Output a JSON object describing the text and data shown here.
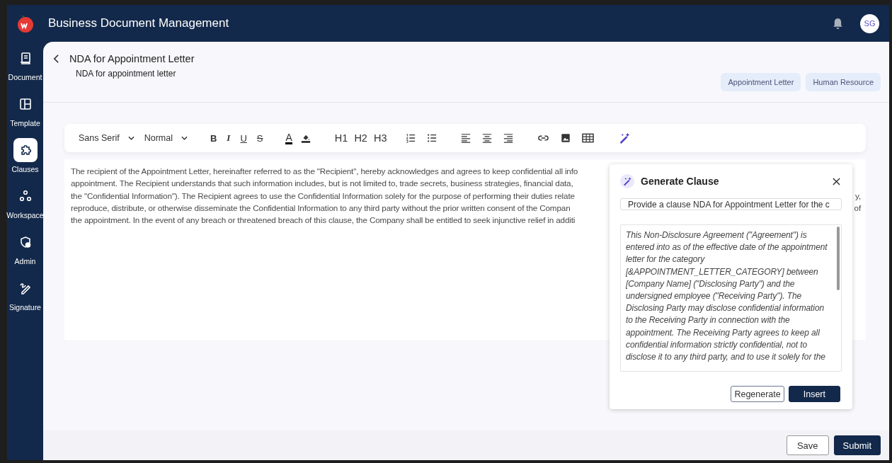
{
  "header": {
    "title": "Business Document Management",
    "avatar": "SG"
  },
  "sidebar": {
    "items": [
      {
        "kind": "document",
        "label": "Document",
        "selected": false
      },
      {
        "kind": "template",
        "label": "Template",
        "selected": false
      },
      {
        "kind": "clauses",
        "label": "Clauses",
        "selected": true
      },
      {
        "kind": "workspace",
        "label": "Workspace",
        "selected": false
      },
      {
        "kind": "admin",
        "label": "Admin",
        "selected": false
      },
      {
        "kind": "signature",
        "label": "Signature",
        "selected": false
      }
    ]
  },
  "page": {
    "title": "NDA for Appointment Letter",
    "subtitle": "NDA for appointment letter",
    "tags": [
      "Appointment Letter",
      "Human Resource"
    ]
  },
  "toolbar": [
    {
      "kind": "select",
      "value": "Sans Serif"
    },
    {
      "kind": "select",
      "value": "Normal"
    },
    {
      "kind": "bold",
      "label": "B"
    },
    {
      "kind": "italic",
      "label": "I"
    },
    {
      "kind": "underline",
      "label": "U"
    },
    {
      "kind": "strike",
      "label": "S"
    },
    {
      "kind": "text-color",
      "label": "A"
    },
    {
      "kind": "highlight"
    },
    {
      "kind": "heading",
      "label": "H1"
    },
    {
      "kind": "heading",
      "label": "H2"
    },
    {
      "kind": "heading",
      "label": "H3"
    },
    {
      "kind": "ordered-list"
    },
    {
      "kind": "bullet-list"
    },
    {
      "kind": "align-left"
    },
    {
      "kind": "align-center"
    },
    {
      "kind": "align-right"
    },
    {
      "kind": "link"
    },
    {
      "kind": "image"
    },
    {
      "kind": "table"
    },
    {
      "kind": "magic"
    }
  ],
  "editor": {
    "lines": [
      {
        "text": "The recipient of the Appointment Letter, hereinafter referred to as the \"Recipient\", hereby acknowledges and agrees to keep confidential all info"
      },
      {
        "text": "appointment. The Recipient understands that such information includes, but is not limited to, trade secrets, business strategies, financial data,"
      },
      {
        "text": "the \"Confidential Information\"). The Recipient agrees to use the Confidential Information solely for the purpose of performing their duties relate",
        "tail": "y,"
      },
      {
        "text": "reproduce, distribute, or otherwise disseminate the Confidential Information to any third party without the prior written consent of the Compan",
        "tail": "of"
      },
      {
        "text": "the appointment. In the event of any breach or threatened breach of this clause, the Company shall be entitled to seek injunctive relief in additi"
      }
    ]
  },
  "dialog": {
    "title": "Generate Clause",
    "prompt": "Provide a clause NDA for Appointment Letter for the c",
    "result": "This Non-Disclosure Agreement (\"Agreement\") is entered into as of the effective date of the appointment letter for the category [&APPOINTMENT_LETTER_CATEGORY] between [Company Name] (\"Disclosing Party\") and the undersigned employee (\"Receiving Party\"). The Disclosing Party may disclose confidential information to the Receiving Party in connection with the appointment. The Receiving Party agrees to keep all confidential information strictly confidential, not to disclose it to any third party, and to use it solely for the",
    "buttons": [
      {
        "kind": "secondary",
        "label": "Regenerate"
      },
      {
        "kind": "primary",
        "label": "Insert"
      }
    ]
  },
  "footer": {
    "buttons": [
      {
        "kind": "secondary",
        "label": "Save"
      },
      {
        "kind": "primary",
        "label": "Submit"
      }
    ]
  }
}
